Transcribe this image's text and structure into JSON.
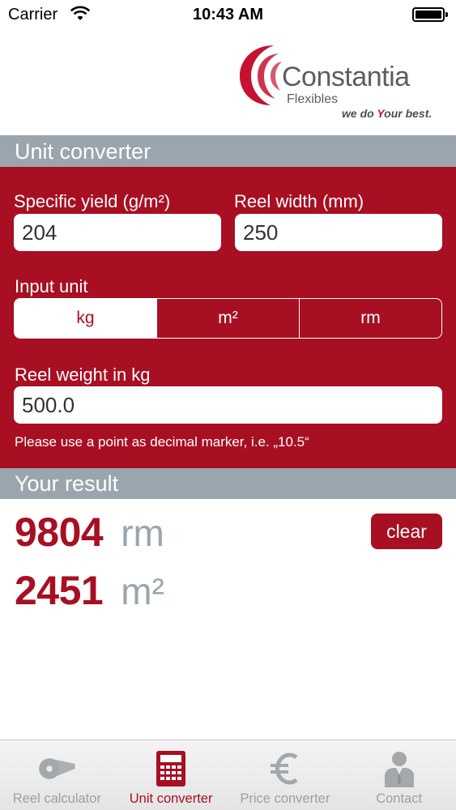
{
  "status_bar": {
    "carrier": "Carrier",
    "time": "10:43 AM"
  },
  "logo": {
    "name": "Constantia",
    "sub": "Flexibles",
    "tagline_pre": "we do ",
    "tagline_y": "Y",
    "tagline_post": "our best."
  },
  "sections": {
    "converter_title": "Unit converter",
    "result_title": "Your result"
  },
  "form": {
    "specific_yield_label": "Specific yield (g/m²)",
    "specific_yield_value": "204",
    "reel_width_label": "Reel width (mm)",
    "reel_width_value": "250",
    "input_unit_label": "Input unit",
    "units": [
      "kg",
      "m²",
      "rm"
    ],
    "selected_unit": "kg",
    "reel_weight_label": "Reel weight in kg",
    "reel_weight_value": "500.0",
    "hint": "Please use a point as decimal marker, i.e. „10.5“"
  },
  "result": {
    "rows": [
      {
        "value": "9804",
        "unit": "rm"
      },
      {
        "value": "2451",
        "unit": "m²"
      }
    ],
    "clear_label": "clear"
  },
  "tabs": [
    {
      "label": "Reel calculator",
      "icon": "reel-icon",
      "active": false
    },
    {
      "label": "Unit converter",
      "icon": "calculator-icon",
      "active": true
    },
    {
      "label": "Price converter",
      "icon": "euro-icon",
      "active": false
    },
    {
      "label": "Contact",
      "icon": "person-icon",
      "active": false
    }
  ],
  "colors": {
    "brand_red": "#a80f22",
    "header_gray": "#9aa5ad",
    "tab_inactive": "#9aa0a5"
  }
}
